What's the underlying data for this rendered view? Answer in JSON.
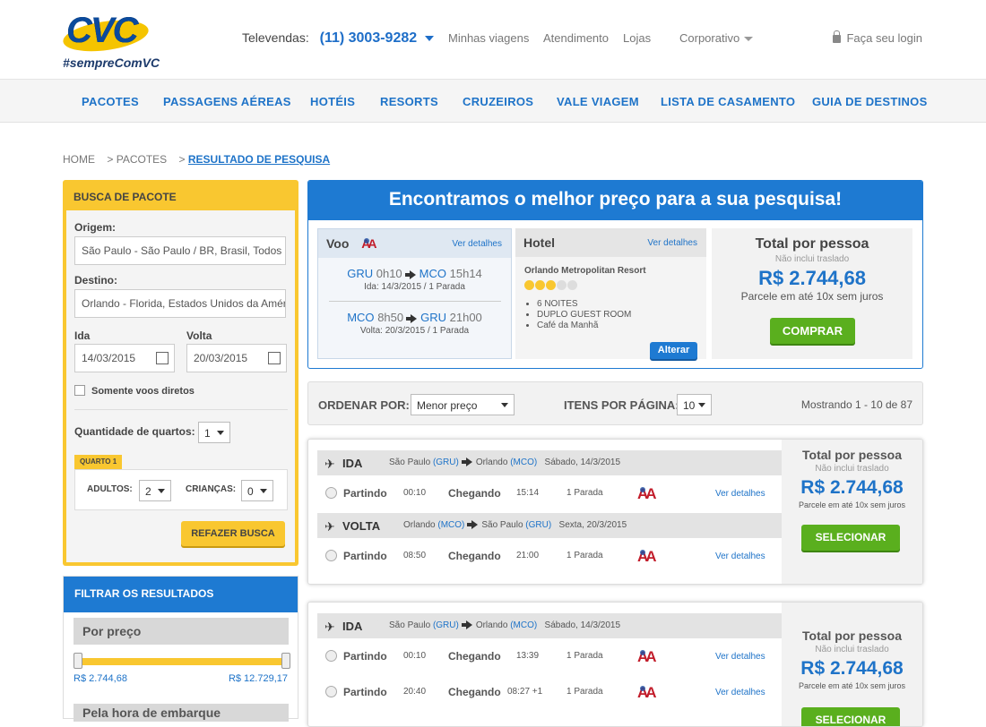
{
  "header": {
    "logo_text": "CVC",
    "tagline": "#sempreComVC",
    "televendas_label": "Televendas:",
    "televendas_number": "(11) 3003-9282",
    "links": [
      "Minhas viagens",
      "Atendimento",
      "Lojas",
      "Corporativo"
    ],
    "login": "Faça seu login"
  },
  "nav": [
    "PACOTES",
    "PASSAGENS AÉREAS",
    "HOTÉIS",
    "RESORTS",
    "CRUZEIROS",
    "VALE VIAGEM",
    "LISTA DE CASAMENTO",
    "GUIA DE DESTINOS"
  ],
  "breadcrumb": {
    "home": "HOME",
    "sep": ">",
    "pacotes": "PACOTES",
    "current": "RESULTADO DE PESQUISA"
  },
  "search": {
    "title": "BUSCA DE PACOTE",
    "origem_label": "Origem:",
    "origem_value": "São Paulo - São Paulo / BR, Brasil, Todos",
    "destino_label": "Destino:",
    "destino_value": "Orlando - Florida, Estados Unidos da América",
    "ida_label": "Ida",
    "ida_value": "14/03/2015",
    "volta_label": "Volta",
    "volta_value": "20/03/2015",
    "direct_label": "Somente voos diretos",
    "quartos_label": "Quantidade de quartos:",
    "quartos_value": "1",
    "quarto_tab": "QUARTO 1",
    "adultos_label": "ADULTOS:",
    "adultos_value": "2",
    "criancas_label": "CRIANÇAS:",
    "criancas_value": "0",
    "submit": "REFAZER BUSCA"
  },
  "filter": {
    "title": "FILTRAR OS RESULTADOS",
    "price_title": "Por preço",
    "price_min": "R$ 2.744,68",
    "price_max": "R$ 12.729,17",
    "next_title": "Pela hora de embarque"
  },
  "best": {
    "title": "Encontramos o melhor preço para a sua pesquisa!",
    "voo_title": "Voo",
    "details_link": "Ver detalhes",
    "out": {
      "from": "GRU",
      "dep": "0h10",
      "to": "MCO",
      "arr": "15h14",
      "info": "Ida: 14/3/2015 /  1 Parada"
    },
    "ret": {
      "from": "MCO",
      "dep": "8h50",
      "to": "GRU",
      "arr": "21h00",
      "info": "Volta: 20/3/2015 / 1 Parada"
    },
    "hotel_title": "Hotel",
    "hotel_name": "Orlando Metropolitan Resort",
    "hotel_stars": 3,
    "hotel_features": [
      "6 NOITES",
      "DUPLO GUEST ROOM",
      "Café da Manhã"
    ],
    "alter": "Alterar",
    "total_title": "Total por pessoa",
    "no_transfer": "Não inclui traslado",
    "price": "R$ 2.744,68",
    "installments": "Parcele em até 10x sem juros",
    "buy": "COMPRAR"
  },
  "sortbar": {
    "order_label": "ORDENAR POR:",
    "order_value": "Menor preço",
    "per_page_label": "ITENS POR PÁGINA:",
    "per_page_value": "10",
    "showing": "Mostrando 1 - 10 de 87"
  },
  "labels": {
    "partindo": "Partindo",
    "chegando": "Chegando",
    "ver": "Ver detalhes",
    "ida": "IDA",
    "volta": "VOLTA",
    "total": "Total por pessoa",
    "no_transfer": "Não inclui traslado",
    "installments": "Parcele em até 10x sem juros",
    "select": "SELECIONAR"
  },
  "results": [
    {
      "price": "R$ 2.744,68",
      "ida_header": {
        "from": "São Paulo",
        "from_code": "(GRU)",
        "to": "Orlando",
        "to_code": "(MCO)",
        "date": "Sábado, 14/3/2015"
      },
      "ida_rows": [
        {
          "dep": "00:10",
          "arr": "15:14",
          "stops": "1 Parada"
        }
      ],
      "volta_header": {
        "from": "Orlando",
        "from_code": "(MCO)",
        "to": "São Paulo",
        "to_code": "(GRU)",
        "date": "Sexta, 20/3/2015"
      },
      "volta_rows": [
        {
          "dep": "08:50",
          "arr": "21:00",
          "stops": "1 Parada"
        }
      ]
    },
    {
      "price": "R$ 2.744,68",
      "ida_header": {
        "from": "São Paulo",
        "from_code": "(GRU)",
        "to": "Orlando",
        "to_code": "(MCO)",
        "date": "Sábado, 14/3/2015"
      },
      "ida_rows": [
        {
          "dep": "00:10",
          "arr": "13:39",
          "stops": "1 Parada"
        },
        {
          "dep": "20:40",
          "arr": "08:27 +1",
          "stops": "1 Parada"
        }
      ]
    }
  ],
  "colors": {
    "brand_blue": "#1e7ad2",
    "yellow": "#f9c730",
    "green": "#5aaf1e"
  }
}
